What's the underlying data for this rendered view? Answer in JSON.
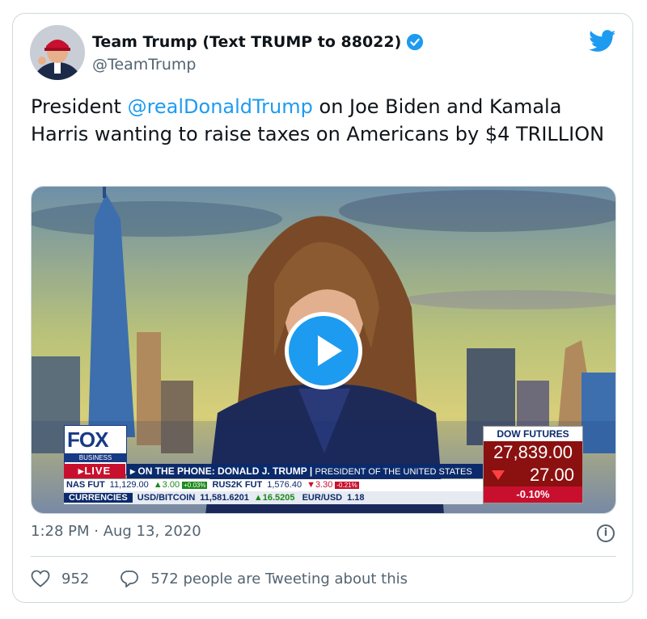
{
  "tweet": {
    "author_name": "Team Trump (Text TRUMP to 88022)",
    "author_handle": "@TeamTrump",
    "text_before": "President ",
    "mention": "@realDonaldTrump",
    "text_after": " on Joe Biden and Kamala Harris wanting to raise taxes on Americans by $4 TRILLION",
    "timestamp": "1:28 PM · Aug 13, 2020",
    "likes": "952",
    "tweeting_about": "572 people are Tweeting about this"
  },
  "video": {
    "fox_word": "FOX",
    "fox_sub": "BUSINESS",
    "live": "LIVE",
    "lower_third_main": "ON THE PHONE: DONALD J. TRUMP",
    "lower_third_sub": "PRESIDENT OF THE UNITED STATES",
    "ticker_row1": [
      {
        "label": "NAS FUT",
        "value": "11,129.00",
        "change": "▲3.00",
        "pct": "+0.03%",
        "dir": "up"
      },
      {
        "label": "RUS2K FUT",
        "value": "1,576.40",
        "change": "▼3.30",
        "pct": "-0.21%",
        "dir": "down"
      }
    ],
    "ticker_row2": {
      "label": "CURRENCIES",
      "item1_label": "USD/BITCOIN",
      "item1_value": "11,581.6201",
      "item1_change": "▲16.5205",
      "item2_label": "EUR/USD",
      "item2_value": "1.18"
    },
    "dow": {
      "title": "DOW FUTURES",
      "value": "27,839.00",
      "change": "27.00",
      "pct": "-0.10%"
    }
  },
  "colors": {
    "accent": "#1d9bf0",
    "text": "#0f1419",
    "muted": "#536471",
    "border": "#cfd9de",
    "fox_blue": "#0b2a6b",
    "fox_red": "#c8102e"
  },
  "icons": [
    "verified-badge-icon",
    "twitter-bird-icon",
    "play-icon",
    "info-icon",
    "heart-icon",
    "reply-bubble-icon"
  ]
}
